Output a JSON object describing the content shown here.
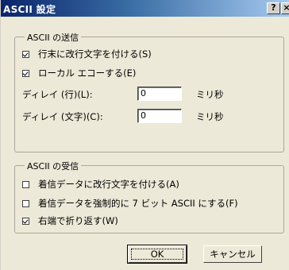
{
  "window": {
    "title": "ASCII 設定",
    "help_glyph": "?",
    "close_glyph": "×"
  },
  "send_group": {
    "label": "ASCII の送信",
    "option_line_feed": {
      "checked": true,
      "label": "行末に改行文字を付ける(S)"
    },
    "option_local_echo": {
      "checked": true,
      "label": "ローカル エコーする(E)"
    },
    "delay_line": {
      "label": "ディレイ (行)(L):",
      "value": "0",
      "unit": "ミリ秒"
    },
    "delay_char": {
      "label": "ディレイ (文字)(C):",
      "value": "0",
      "unit": "ミリ秒"
    }
  },
  "receive_group": {
    "label": "ASCII の受信",
    "option_append_line_feed": {
      "checked": false,
      "label": "着信データに改行文字を付ける(A)"
    },
    "option_force_7bit": {
      "checked": false,
      "label": "着信データを強制的に 7 ビット ASCII にする(F)"
    },
    "option_wrap": {
      "checked": true,
      "label": "右端で折り返す(W)"
    }
  },
  "buttons": {
    "ok_label": "OK",
    "cancel_label": "キャンセル"
  }
}
